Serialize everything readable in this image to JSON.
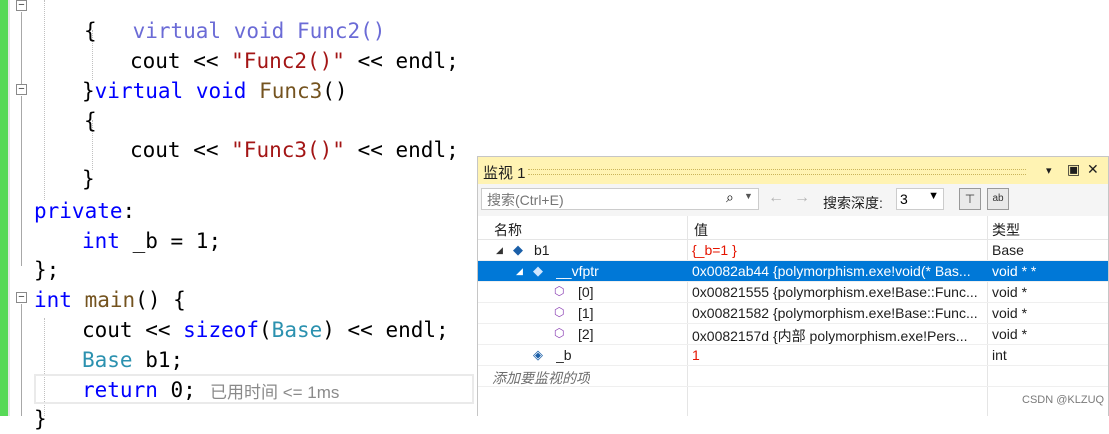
{
  "editor": {
    "lines": [
      {
        "id": "l0",
        "tokens": [
          {
            "t": "    virtual void Func2()",
            "c": "partial"
          }
        ]
      },
      {
        "id": "l1",
        "text": "{"
      },
      {
        "id": "l2",
        "parts": [
          "cout << ",
          "\"Func2()\"",
          " << endl;"
        ]
      },
      {
        "id": "l3",
        "parts": [
          "}",
          "virtual",
          " ",
          "void",
          " ",
          "Func3",
          "()"
        ]
      },
      {
        "id": "l4",
        "text": "{"
      },
      {
        "id": "l5",
        "parts": [
          "cout << ",
          "\"Func3()\"",
          " << endl;"
        ]
      },
      {
        "id": "l6",
        "text": "}"
      },
      {
        "id": "l7",
        "parts": [
          "private",
          ":"
        ]
      },
      {
        "id": "l8",
        "parts": [
          "int",
          " _b = 1;"
        ]
      },
      {
        "id": "l9",
        "text": "};"
      },
      {
        "id": "l10",
        "parts": [
          "int",
          " ",
          "main",
          "() {"
        ]
      },
      {
        "id": "l11",
        "parts": [
          "cout << ",
          "sizeof",
          "(",
          "Base",
          ") << endl;"
        ]
      },
      {
        "id": "l12",
        "parts": [
          "Base",
          " b1;"
        ]
      },
      {
        "id": "l13",
        "parts": [
          "return",
          " 0;"
        ]
      }
    ],
    "top_partial": "virtual void Func2()",
    "elapsed": "已用时间 <= 1ms",
    "bottom_brace": "}"
  },
  "watch": {
    "title": "监视 1",
    "controls": {
      "dropdown": "▾",
      "maximize": "▣",
      "close": "✕"
    },
    "search_placeholder": "搜索(Ctrl+E)",
    "search_icon": "🔍",
    "search_depth_label": "搜索深度:",
    "search_depth_value": "3",
    "columns": {
      "name": "名称",
      "value": "值",
      "type": "类型"
    },
    "rows": [
      {
        "name": "b1",
        "value": "{_b=1 }",
        "type": "Base"
      },
      {
        "name": "__vfptr",
        "value": "0x0082ab44 {polymorphism.exe!void(* Bas...",
        "type": "void * *"
      },
      {
        "name": "[0]",
        "value": "0x00821555 {polymorphism.exe!Base::Func...",
        "type": "void *"
      },
      {
        "name": "[1]",
        "value": "0x00821582 {polymorphism.exe!Base::Func...",
        "type": "void *"
      },
      {
        "name": "[2]",
        "value": "0x0082157d {内部 polymorphism.exe!Pers...",
        "type": "void *"
      },
      {
        "name": "_b",
        "value": "1",
        "type": "int"
      }
    ],
    "add_item": "添加要监视的项"
  },
  "watermark": "CSDN @KLZUQ",
  "colors": {
    "keyword": "#0000ff",
    "type": "#2b91af",
    "function": "#74531f",
    "string": "#a31515",
    "selection": "#0078d7",
    "title_bar": "#fff3b3"
  }
}
